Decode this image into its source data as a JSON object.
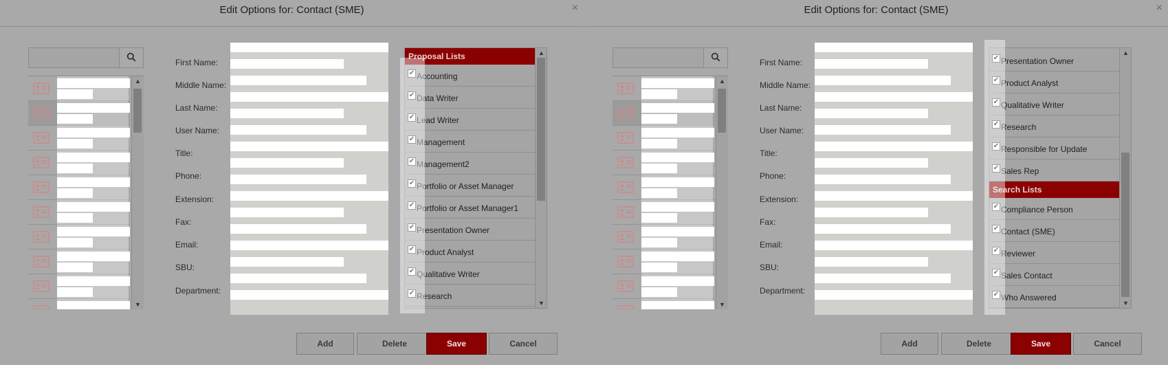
{
  "dialogs": [
    {
      "title": "Edit Options for: Contact (SME)",
      "close_glyph": "×",
      "search": {
        "placeholder": "",
        "value": "",
        "icon": "search-icon"
      },
      "contact_rows": 10,
      "selected_row": 1,
      "form_labels": [
        "First Name:",
        "Middle Name:",
        "Last Name:",
        "User Name:",
        "Title:",
        "Phone:",
        "Extension:",
        "Fax:",
        "Email:",
        "SBU:",
        "Department:"
      ],
      "list_items": [
        {
          "type": "header",
          "label": "Proposal Lists"
        },
        {
          "type": "item",
          "label": "Accounting",
          "checked": true
        },
        {
          "type": "item",
          "label": "Data Writer",
          "checked": true
        },
        {
          "type": "item",
          "label": "Lead Writer",
          "checked": true
        },
        {
          "type": "item",
          "label": "Management",
          "checked": true
        },
        {
          "type": "item",
          "label": "Management2",
          "checked": true
        },
        {
          "type": "item",
          "label": "Portfolio or Asset Manager",
          "checked": true
        },
        {
          "type": "item",
          "label": "Portfolio or Asset Manager1",
          "checked": true
        },
        {
          "type": "item",
          "label": "Presentation Owner",
          "checked": true
        },
        {
          "type": "item",
          "label": "Product Analyst",
          "checked": true
        },
        {
          "type": "item",
          "label": "Qualitative Writer",
          "checked": true
        },
        {
          "type": "item",
          "label": "Research",
          "checked": true
        }
      ],
      "list_scroll_position": 0.0,
      "buttons": {
        "add": "Add",
        "delete": "Delete",
        "save": "Save",
        "cancel": "Cancel"
      }
    },
    {
      "title": "Edit Options for: Contact (SME)",
      "close_glyph": "×",
      "search": {
        "placeholder": "",
        "value": "",
        "icon": "search-icon"
      },
      "contact_rows": 10,
      "selected_row": 1,
      "form_labels": [
        "First Name:",
        "Middle Name:",
        "Last Name:",
        "User Name:",
        "Title:",
        "Phone:",
        "Extension:",
        "Fax:",
        "Email:",
        "SBU:",
        "Department:"
      ],
      "list_items": [
        {
          "type": "item",
          "label": "Presentation Owner",
          "checked": true
        },
        {
          "type": "item",
          "label": "Product Analyst",
          "checked": true
        },
        {
          "type": "item",
          "label": "Qualitative Writer",
          "checked": true
        },
        {
          "type": "item",
          "label": "Research",
          "checked": true
        },
        {
          "type": "item",
          "label": "Responsible for Update",
          "checked": true
        },
        {
          "type": "item",
          "label": "Sales Rep",
          "checked": true
        },
        {
          "type": "header",
          "label": "Search Lists"
        },
        {
          "type": "item",
          "label": "Compliance Person",
          "checked": true
        },
        {
          "type": "item",
          "label": "Contact (SME)",
          "checked": true
        },
        {
          "type": "item",
          "label": "Reviewer",
          "checked": true
        },
        {
          "type": "item",
          "label": "Sales Contact",
          "checked": true
        },
        {
          "type": "item",
          "label": "Who Answered",
          "checked": true
        }
      ],
      "list_scroll_position": 1.0,
      "buttons": {
        "add": "Add",
        "delete": "Delete",
        "save": "Save",
        "cancel": "Cancel"
      }
    }
  ],
  "colors": {
    "accent": "#8b0000",
    "background": "#a9a9a9",
    "panel": "#d0d0cd",
    "icon": "#c98b8b"
  }
}
